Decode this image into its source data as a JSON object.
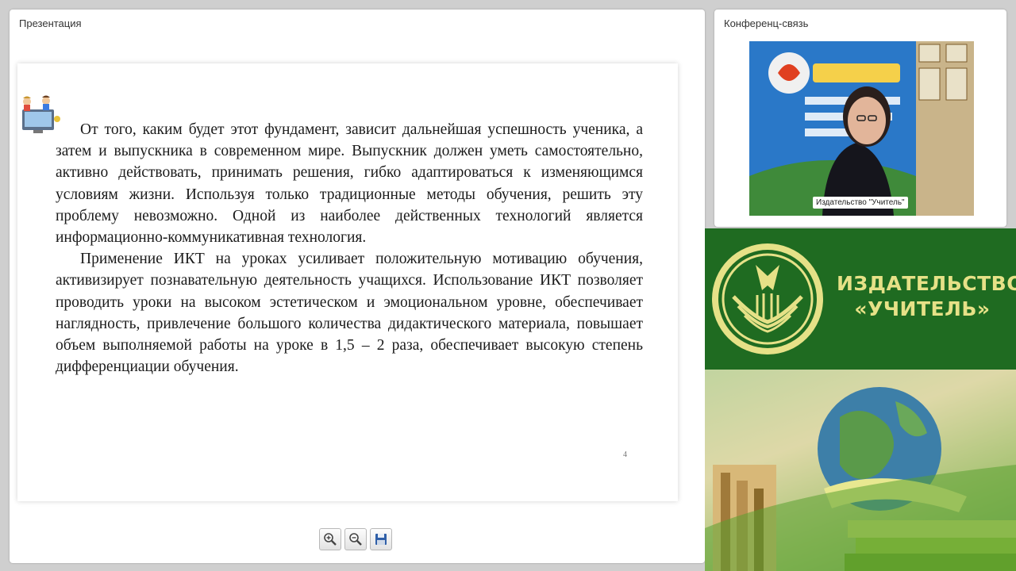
{
  "presentation_panel": {
    "title": "Презентация",
    "slide": {
      "paragraphs": [
        "От того, каким будет этот фундамент, зависит дальнейшая успешность ученика, а затем и выпускника в современном мире. Выпускник должен уметь самостоятельно, активно действовать, принимать решения, гибко адаптироваться к изменяющимся условиям жизни. Используя только традиционные методы обучения, решить эту проблему невозможно. Одной из наиболее действенных технологий является информационно-коммуникативная технология.",
        "Применение ИКТ на уроках усиливает положительную мотивацию обучения, активизирует познавательную деятельность учащихся. Использование ИКТ позволяет проводить уроки на высоком эстетическом и эмоциональном уровне, обеспечивает наглядность, привлечение большого количества дидактического материала, повышает объем выполняемой работы на уроке в 1,5 – 2 раза, обеспечивает высокую степень дифференциации обучения."
      ],
      "page_number": "4"
    },
    "toolbar": [
      {
        "name": "zoom-in-button",
        "icon": "zoom-in-icon"
      },
      {
        "name": "zoom-out-button",
        "icon": "zoom-out-icon"
      },
      {
        "name": "save-button",
        "icon": "save-icon"
      }
    ]
  },
  "conference_panel": {
    "title": "Конференц-связь",
    "video_label": "Издательство \"Учитель\""
  },
  "brand": {
    "name_line1": "ИЗДАТЕЛЬСТВО",
    "name_line2": "«УЧИТЕЛЬ»",
    "colors": {
      "banner": "#1f6b21",
      "text": "#e6e187"
    }
  }
}
